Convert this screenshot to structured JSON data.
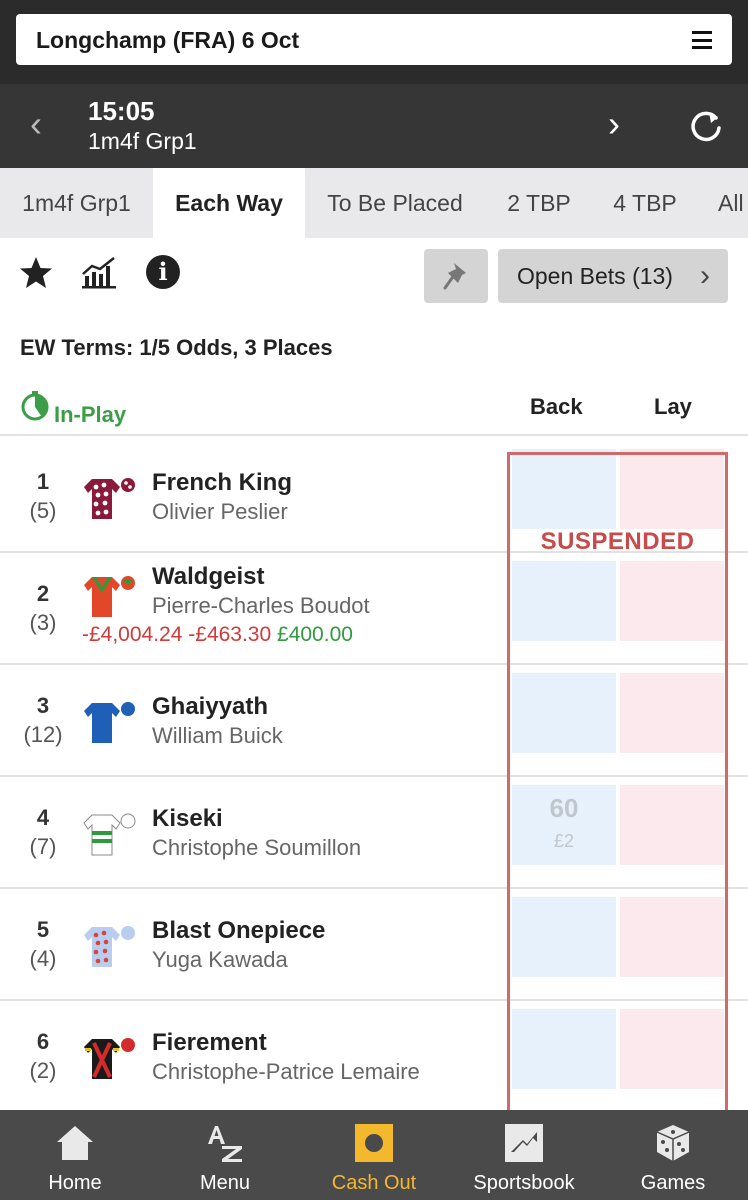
{
  "header": {
    "market_title": "Longchamp (FRA) 6 Oct"
  },
  "race": {
    "time": "15:05",
    "description": "1m4f Grp1"
  },
  "tabs": [
    {
      "label": "1m4f Grp1",
      "active": false
    },
    {
      "label": "Each Way",
      "active": true
    },
    {
      "label": "To Be Placed",
      "active": false
    },
    {
      "label": "2 TBP",
      "active": false
    },
    {
      "label": "4 TBP",
      "active": false
    },
    {
      "label": "All",
      "active": false
    }
  ],
  "toolbar": {
    "open_bets_label": "Open Bets (13)"
  },
  "ew_terms": "EW Terms: 1/5 Odds, 3 Places",
  "market": {
    "status_label": "In-Play",
    "back_label": "Back",
    "lay_label": "Lay",
    "suspended_label": "SUSPENDED"
  },
  "runners": [
    {
      "number": "1",
      "draw": "(5)",
      "name": "French King",
      "jockey": "Olivier Peslier"
    },
    {
      "number": "2",
      "draw": "(3)",
      "name": "Waldgeist",
      "jockey": "Pierre-Charles Boudot",
      "pnl": {
        "win": "-£4,004.24",
        "place": "-£463.30",
        "other": "£400.00"
      }
    },
    {
      "number": "3",
      "draw": "(12)",
      "name": "Ghaiyyath",
      "jockey": "William Buick"
    },
    {
      "number": "4",
      "draw": "(7)",
      "name": "Kiseki",
      "jockey": "Christophe Soumillon",
      "back_odds": "60",
      "back_stake": "£2"
    },
    {
      "number": "5",
      "draw": "(4)",
      "name": "Blast Onepiece",
      "jockey": "Yuga Kawada"
    },
    {
      "number": "6",
      "draw": "(2)",
      "name": "Fierement",
      "jockey": "Christophe-Patrice Lemaire"
    }
  ],
  "bottom_nav": [
    {
      "label": "Home",
      "icon": "home-icon"
    },
    {
      "label": "Menu",
      "icon": "az-menu-icon"
    },
    {
      "label": "Cash Out",
      "icon": "cash-out-icon",
      "active": true
    },
    {
      "label": "Sportsbook",
      "icon": "sportsbook-icon"
    },
    {
      "label": "Games",
      "icon": "dice-icon"
    }
  ],
  "colors": {
    "header_bg": "#2b2b2b",
    "race_bar_bg": "#363636",
    "inplay_green": "#3b9d46",
    "suspended_red": "#c94a4a",
    "back_blue": "#e6f1fc",
    "lay_pink": "#fbe9ee",
    "cash_out_gold": "#f4b82d"
  }
}
